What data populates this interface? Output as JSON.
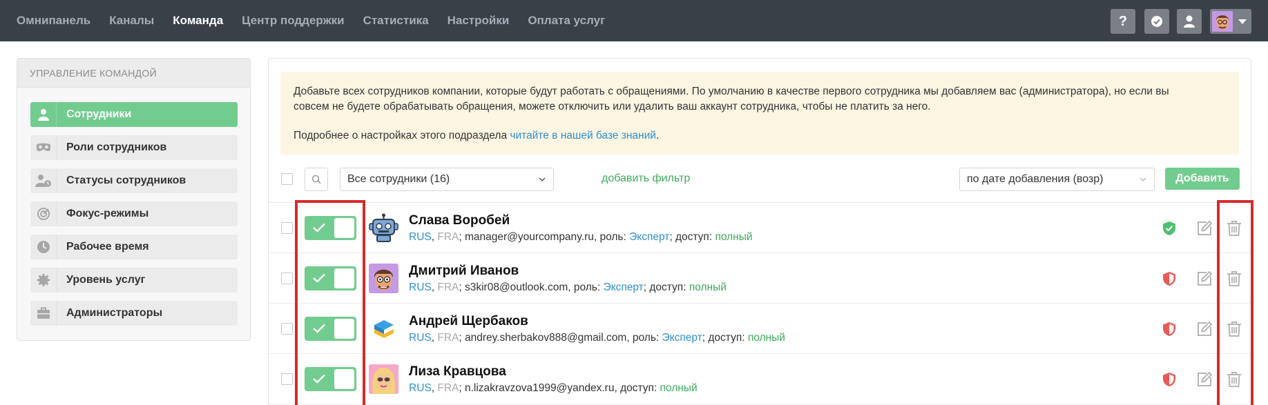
{
  "nav": {
    "items": [
      "Омнипанель",
      "Каналы",
      "Команда",
      "Центр поддержки",
      "Статистика",
      "Настройки",
      "Оплата услуг"
    ],
    "active": "Команда",
    "help_label": "?"
  },
  "sidebar": {
    "title": "УПРАВЛЕНИЕ КОМАНДОЙ",
    "items": [
      {
        "label": "Сотрудники",
        "icon": "user-icon"
      },
      {
        "label": "Роли сотрудников",
        "icon": "mask-icon"
      },
      {
        "label": "Статусы сотрудников",
        "icon": "user-status-icon"
      },
      {
        "label": "Фокус-режимы",
        "icon": "focus-icon"
      },
      {
        "label": "Рабочее время",
        "icon": "clock-icon"
      },
      {
        "label": "Уровень услуг",
        "icon": "gear-icon"
      },
      {
        "label": "Администраторы",
        "icon": "briefcase-icon"
      }
    ]
  },
  "notice": {
    "line1": "Добавьте всех сотрудников компании, которые будут работать с обращениями. По умолчанию в качестве первого сотрудника мы добавляем вас (администратора), но если вы",
    "line2": "совсем не будете обрабатывать обращения, можете отключить или удалить ваш аккаунт сотрудника, чтобы не платить за него.",
    "more_prefix": "Подробнее о настройках этого подраздела ",
    "more_link": "читайте в нашей базе знаний",
    "more_suffix": "."
  },
  "toolbar": {
    "filter_value": "Все сотрудники (16)",
    "add_filter": "добавить фильтр",
    "sort_value": "по дате добавления (возр)",
    "add_button": "Добавить"
  },
  "employees": [
    {
      "name": "Слава Воробей",
      "lang1": "RUS",
      "lang2": "FRA",
      "email": "; manager@yourcompany.ru",
      "has_role": true,
      "role": "Эксперт",
      "access": "полный",
      "shield": "green",
      "avatar": "robot-avatar"
    },
    {
      "name": "Дмитрий Иванов",
      "lang1": "RUS",
      "lang2": "FRA",
      "email": "; s3kir08@outlook.com",
      "has_role": true,
      "role": "Эксперт",
      "access": "полный",
      "shield": "red",
      "avatar": "man-avatar"
    },
    {
      "name": "Андрей Щербаков",
      "lang1": "RUS",
      "lang2": "FRA",
      "email": "; andrey.sherbakov888@gmail.com",
      "has_role": true,
      "role": "Эксперт",
      "access": "полный",
      "shield": "red",
      "avatar": "logo-avatar"
    },
    {
      "name": "Лиза Кравцова",
      "lang1": "RUS",
      "lang2": "FRA",
      "email": "; n.lizakravzova1999@yandex.ru",
      "has_role": false,
      "role": "",
      "access": "полный",
      "shield": "red",
      "avatar": "woman-avatar"
    }
  ],
  "labels": {
    "comma": ", ",
    "role_label": ", роль: ",
    "access_label": "; доступ: ",
    "access_label_norole": ", доступ: "
  },
  "colors": {
    "nav_bg": "#3a4048",
    "accent_green": "#72cc8f",
    "link_blue": "#2e8fd0",
    "notice_bg": "#fcf5e1",
    "highlight_red": "#d52b2b"
  }
}
